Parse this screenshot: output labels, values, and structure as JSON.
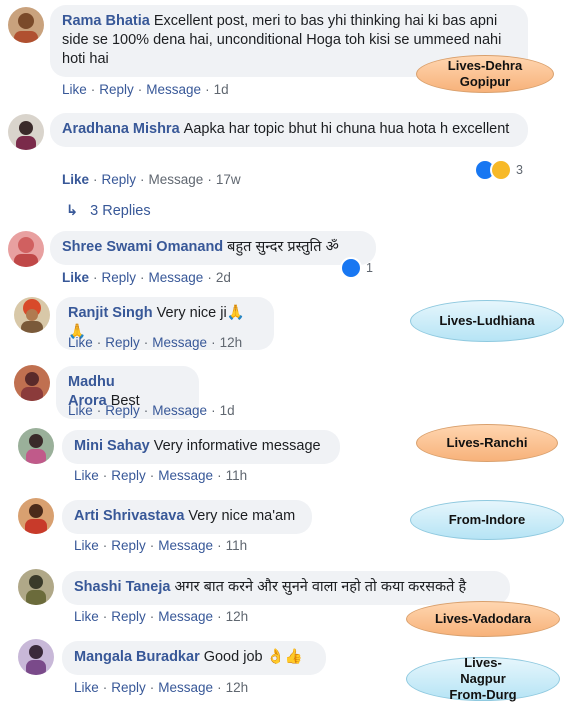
{
  "actions": {
    "like": "Like",
    "reply": "Reply",
    "message": "Message"
  },
  "comments": [
    {
      "name": "Rama Bhatia",
      "text": "Excellent post, meri to bas yhi thinking hai ki bas apni side se 100% dena hai, unconditional Hoga toh kisi se ummeed nahi hoti hai",
      "time": "1d",
      "liked": false,
      "reaction_count": "",
      "avatar_color": "#b07a4f"
    },
    {
      "name": "Aradhana Mishra",
      "text": "Aapka har topic bhut hi chuna hua hota h excellent",
      "time": "17w",
      "liked": true,
      "reaction_count": "3",
      "avatar_color": "#8a5a6a"
    },
    {
      "name": "Shree Swami Omanand",
      "text": "बहुत सुन्दर प्रस्तुति ॐ",
      "time": "2d",
      "liked": true,
      "reaction_count": "1",
      "avatar_color": "#d2787a"
    },
    {
      "name": "Ranjit Singh",
      "text": "Very nice ji🙏🙏",
      "time": "12h",
      "liked": false,
      "reaction_count": "",
      "avatar_color": "#9a6a40"
    },
    {
      "name": "Madhu Arora",
      "text": "Best",
      "time": "1d",
      "liked": false,
      "reaction_count": "",
      "avatar_color": "#8b3b3b"
    },
    {
      "name": "Mini Sahay",
      "text": "Very informative message",
      "time": "11h",
      "liked": false,
      "reaction_count": "",
      "avatar_color": "#5a7a5a"
    },
    {
      "name": "Arti Shrivastava",
      "text": "Very nice ma'am",
      "time": "11h",
      "liked": false,
      "reaction_count": "",
      "avatar_color": "#a5543a"
    },
    {
      "name": "Shashi Taneja",
      "text": "अगर बात करने और सुनने वाला नहो तो कया करसकते है",
      "time": "12h",
      "liked": false,
      "reaction_count": "",
      "avatar_color": "#6b6b3b"
    },
    {
      "name": "Mangala Buradkar",
      "text": "Good job 👌👍",
      "time": "12h",
      "liked": false,
      "reaction_count": "",
      "avatar_color": "#7a4a8a"
    }
  ],
  "replies_link": "3 Replies",
  "annotations": [
    {
      "label": "Lives-Dehra Gopipur",
      "style": "orange"
    },
    {
      "label": "Lives-Ludhiana",
      "style": "blue"
    },
    {
      "label": "Lives-Ranchi",
      "style": "orange"
    },
    {
      "label": "From-Indore",
      "style": "blue"
    },
    {
      "label": "Lives-Vadodara",
      "style": "orange"
    },
    {
      "label": "Lives-Nagpur From-Durg",
      "style": "blue"
    }
  ]
}
